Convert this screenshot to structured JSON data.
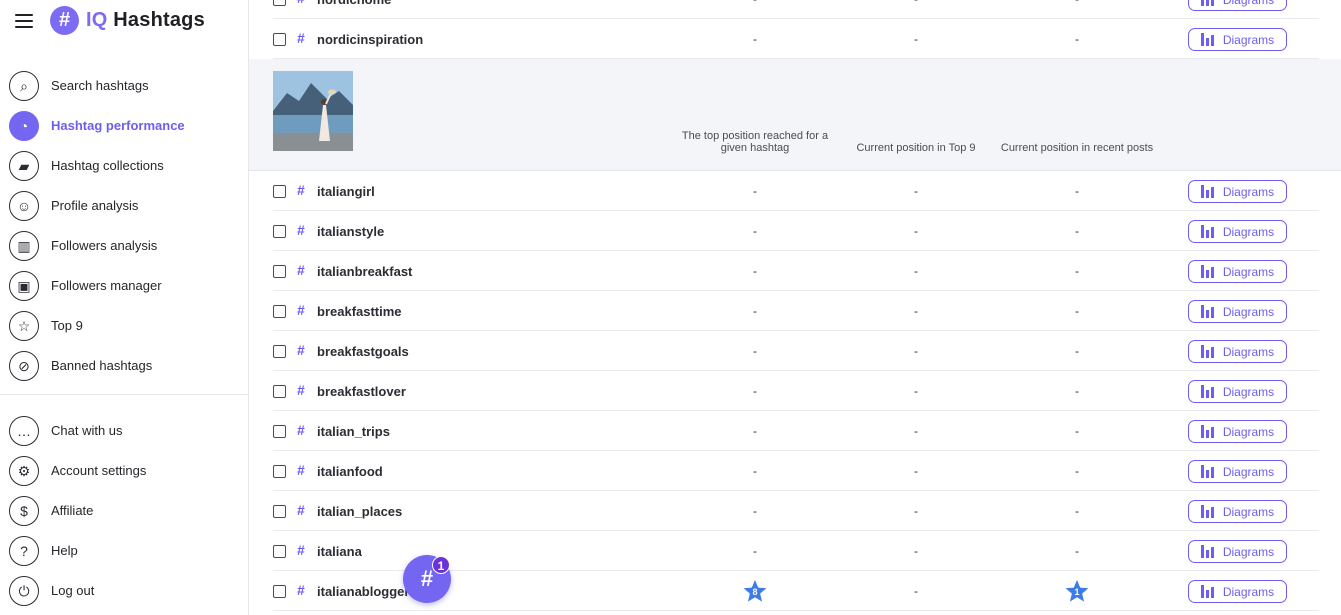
{
  "brand": {
    "prefix": "IQ",
    "name": "Hashtags",
    "badge_symbol": "#"
  },
  "sidebar": {
    "main_items": [
      {
        "label": "Search hashtags",
        "icon": "search-icon",
        "glyph": "⌕",
        "active": false
      },
      {
        "label": "Hashtag performance",
        "icon": "gauge-icon",
        "glyph": "◔",
        "active": true
      },
      {
        "label": "Hashtag collections",
        "icon": "folder-icon",
        "glyph": "▰",
        "active": false
      },
      {
        "label": "Profile analysis",
        "icon": "face-icon",
        "glyph": "☺",
        "active": false
      },
      {
        "label": "Followers analysis",
        "icon": "chart-icon",
        "glyph": "▥",
        "active": false
      },
      {
        "label": "Followers manager",
        "icon": "contact-card-icon",
        "glyph": "▣",
        "active": false
      },
      {
        "label": "Top 9",
        "icon": "star-icon",
        "glyph": "☆",
        "active": false
      },
      {
        "label": "Banned hashtags",
        "icon": "ban-icon",
        "glyph": "⊘",
        "active": false
      }
    ],
    "bottom_items": [
      {
        "label": "Chat with us",
        "icon": "chat-icon",
        "glyph": "…"
      },
      {
        "label": "Account settings",
        "icon": "gear-icon",
        "glyph": "⚙"
      },
      {
        "label": "Affiliate",
        "icon": "dollar-icon",
        "glyph": "$"
      },
      {
        "label": "Help",
        "icon": "question-icon",
        "glyph": "?"
      },
      {
        "label": "Log out",
        "icon": "power-icon",
        "glyph": "⏻"
      }
    ]
  },
  "table": {
    "diagrams_label": "Diagrams",
    "top_rows": [
      {
        "tag": "nordichome",
        "top_position": "-",
        "top9_position": "-",
        "recent_position": "-"
      },
      {
        "tag": "nordicinspiration",
        "top_position": "-",
        "top9_position": "-",
        "recent_position": "-"
      }
    ],
    "post_header": {
      "top_position": "The top position reached for a given hashtag",
      "top9_position": "Current position in Top 9",
      "recent_position": "Current position in recent posts"
    },
    "rows": [
      {
        "tag": "italiangirl",
        "top_position": "-",
        "top9_position": "-",
        "recent_position": "-"
      },
      {
        "tag": "italianstyle",
        "top_position": "-",
        "top9_position": "-",
        "recent_position": "-"
      },
      {
        "tag": "italianbreakfast",
        "top_position": "-",
        "top9_position": "-",
        "recent_position": "-"
      },
      {
        "tag": "breakfasttime",
        "top_position": "-",
        "top9_position": "-",
        "recent_position": "-"
      },
      {
        "tag": "breakfastgoals",
        "top_position": "-",
        "top9_position": "-",
        "recent_position": "-"
      },
      {
        "tag": "breakfastlover",
        "top_position": "-",
        "top9_position": "-",
        "recent_position": "-"
      },
      {
        "tag": "italian_trips",
        "top_position": "-",
        "top9_position": "-",
        "recent_position": "-"
      },
      {
        "tag": "italianfood",
        "top_position": "-",
        "top9_position": "-",
        "recent_position": "-"
      },
      {
        "tag": "italian_places",
        "top_position": "-",
        "top9_position": "-",
        "recent_position": "-"
      },
      {
        "tag": "italiana",
        "top_position": "-",
        "top9_position": "-",
        "recent_position": "-"
      },
      {
        "tag": "italianabloggerstrip",
        "top_position": "8",
        "top9_position": "-",
        "recent_position": "1"
      }
    ]
  },
  "fab": {
    "symbol": "#",
    "badge_count": "1"
  },
  "colors": {
    "accent": "#6c5ef0",
    "star": "#3d7be8"
  }
}
